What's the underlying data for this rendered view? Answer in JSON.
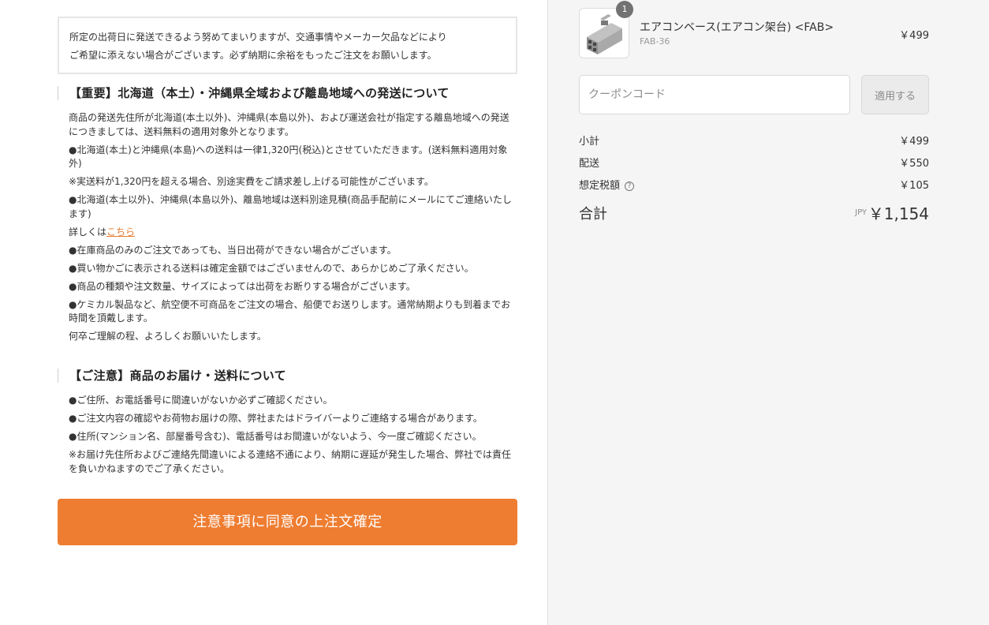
{
  "notice": {
    "line1": "所定の出荷日に発送できるよう努めてまいりますが、交通事情やメーカー欠品などにより",
    "line2": "ご希望に添えない場合がございます。必ず納期に余裕をもったご注文をお願いします。"
  },
  "section1": {
    "title": "【重要】北海道（本土）・沖縄県全域および離島地域への発送について",
    "lines": [
      "商品の発送先住所が北海道(本土以外)、沖縄県(本島以外)、および運送会社が指定する離島地域への発送につきましては、送料無料の適用対象外となります。",
      "●北海道(本土)と沖縄県(本島)への送料は一律1,320円(税込)とさせていただきます。(送料無料適用対象外)",
      "※実送料が1,320円を超える場合、別途実費をご請求差し上げる可能性がございます。",
      "●北海道(本土以外)、沖縄県(本島以外)、離島地域は送料別途見積(商品手配前にメールにてご連絡いたします)"
    ],
    "details_prefix": "詳しくは",
    "details_link": "こちら",
    "lines2": [
      "●在庫商品のみのご注文であっても、当日出荷ができない場合がございます。",
      "●買い物かごに表示される送料は確定金額ではございませんので、あらかじめご了承ください。",
      "●商品の種類や注文数量、サイズによっては出荷をお断りする場合がございます。",
      "●ケミカル製品など、航空便不可商品をご注文の場合、船便でお送りします。通常納期よりも到着までお時間を頂戴します。",
      "何卒ご理解の程、よろしくお願いいたします。"
    ]
  },
  "section2": {
    "title": "【ご注意】商品のお届け・送料について",
    "lines": [
      "●ご住所、お電話番号に間違いがないか必ずご確認ください。",
      "●ご注文内容の確認やお荷物お届けの際、弊社またはドライバーよりご連絡する場合があります。",
      "●住所(マンション名、部屋番号含む)、電話番号はお間違いがないよう、今一度ご確認ください。",
      "※お届け先住所およびご連絡先間違いによる連絡不通により、納期に遅延が発生した場合、弊社では責任を負いかねますのでご了承ください。"
    ]
  },
  "confirm_button": "注意事項に同意の上注文確定",
  "cart": {
    "product": {
      "quantity": "1",
      "name": "エアコンベース(エアコン架台) <FAB>",
      "sku": "FAB-36",
      "price": "￥499",
      "image_icon": "aircon-base-product-image"
    },
    "coupon": {
      "placeholder": "クーポンコード",
      "apply_label": "適用する"
    },
    "summary": {
      "subtotal_label": "小計",
      "subtotal_value": "￥499",
      "shipping_label": "配送",
      "shipping_value": "￥550",
      "tax_label": "想定税額",
      "tax_help": "?",
      "tax_value": "￥105",
      "total_label": "合計",
      "total_currency": "JPY",
      "total_value": "￥1,154"
    }
  },
  "colors": {
    "accent": "#ee7d31",
    "link": "#e87c30",
    "sidebar_bg": "#f5f5f5"
  }
}
